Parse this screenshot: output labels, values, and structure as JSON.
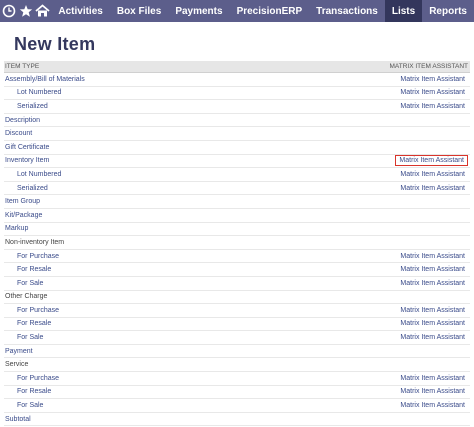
{
  "nav": {
    "icons": [
      "recent-icon",
      "star-icon",
      "home-icon"
    ],
    "items": [
      {
        "label": "Activities"
      },
      {
        "label": "Box Files"
      },
      {
        "label": "Payments"
      },
      {
        "label": "PrecisionERP"
      },
      {
        "label": "Transactions"
      },
      {
        "label": "Lists",
        "active": true
      },
      {
        "label": "Reports"
      }
    ]
  },
  "page": {
    "title": "New Item"
  },
  "table": {
    "col_item_type": "ITEM TYPE",
    "col_matrix": "MATRIX ITEM ASSISTANT",
    "rows": [
      {
        "label": "Assembly/Bill of Materials",
        "kind": "link",
        "action": "Matrix Item Assistant"
      },
      {
        "label": "Lot Numbered",
        "kind": "sub",
        "action": "Matrix Item Assistant"
      },
      {
        "label": "Serialized",
        "kind": "sub",
        "action": "Matrix Item Assistant"
      },
      {
        "label": "Description",
        "kind": "link",
        "action": ""
      },
      {
        "label": "Discount",
        "kind": "link",
        "action": ""
      },
      {
        "label": "Gift Certificate",
        "kind": "link",
        "action": ""
      },
      {
        "label": "Inventory Item",
        "kind": "link",
        "action": "Matrix Item Assistant",
        "highlight": true
      },
      {
        "label": "Lot Numbered",
        "kind": "sub",
        "action": "Matrix Item Assistant"
      },
      {
        "label": "Serialized",
        "kind": "sub",
        "action": "Matrix Item Assistant"
      },
      {
        "label": "Item Group",
        "kind": "link",
        "action": ""
      },
      {
        "label": "Kit/Package",
        "kind": "link",
        "action": ""
      },
      {
        "label": "Markup",
        "kind": "link",
        "action": ""
      },
      {
        "label": "Non-inventory Item",
        "kind": "cat",
        "action": ""
      },
      {
        "label": "For Purchase",
        "kind": "sub",
        "action": "Matrix Item Assistant"
      },
      {
        "label": "For Resale",
        "kind": "sub",
        "action": "Matrix Item Assistant"
      },
      {
        "label": "For Sale",
        "kind": "sub",
        "action": "Matrix Item Assistant"
      },
      {
        "label": "Other Charge",
        "kind": "cat",
        "action": ""
      },
      {
        "label": "For Purchase",
        "kind": "sub",
        "action": "Matrix Item Assistant"
      },
      {
        "label": "For Resale",
        "kind": "sub",
        "action": "Matrix Item Assistant"
      },
      {
        "label": "For Sale",
        "kind": "sub",
        "action": "Matrix Item Assistant"
      },
      {
        "label": "Payment",
        "kind": "link",
        "action": ""
      },
      {
        "label": "Service",
        "kind": "cat",
        "action": ""
      },
      {
        "label": "For Purchase",
        "kind": "sub",
        "action": "Matrix Item Assistant"
      },
      {
        "label": "For Resale",
        "kind": "sub",
        "action": "Matrix Item Assistant"
      },
      {
        "label": "For Sale",
        "kind": "sub",
        "action": "Matrix Item Assistant"
      },
      {
        "label": "Subtotal",
        "kind": "link",
        "action": ""
      }
    ]
  },
  "colors": {
    "navbar": "#5c5e8b",
    "nav_active": "#33365c",
    "link": "#3a4b8a",
    "title": "#34385e",
    "highlight": "#d9342b"
  }
}
